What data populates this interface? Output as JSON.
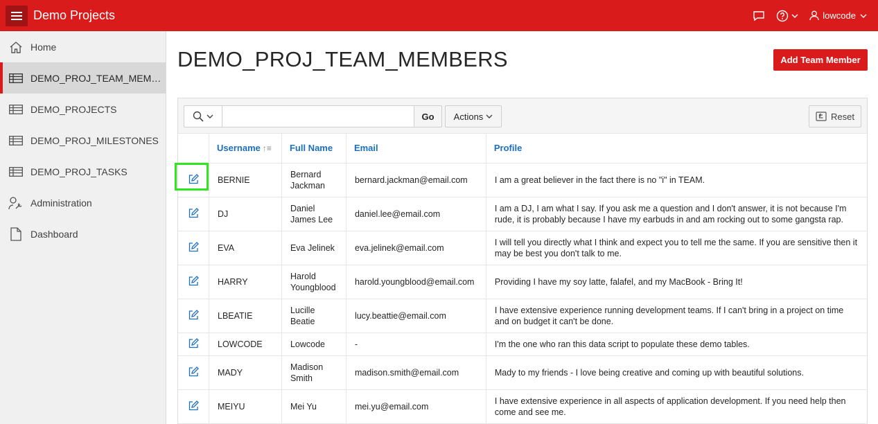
{
  "app": {
    "title": "Demo Projects"
  },
  "topbar": {
    "user_name": "lowcode"
  },
  "sidebar": {
    "items": [
      {
        "label": "Home",
        "icon": "home-icon"
      },
      {
        "label": "DEMO_PROJ_TEAM_MEMBERS",
        "icon": "table-icon",
        "active": true
      },
      {
        "label": "DEMO_PROJECTS",
        "icon": "table-icon"
      },
      {
        "label": "DEMO_PROJ_MILESTONES",
        "icon": "table-icon"
      },
      {
        "label": "DEMO_PROJ_TASKS",
        "icon": "table-icon"
      },
      {
        "label": "Administration",
        "icon": "wrench-user-icon"
      },
      {
        "label": "Dashboard",
        "icon": "document-icon"
      }
    ]
  },
  "page": {
    "title": "DEMO_PROJ_TEAM_MEMBERS",
    "add_button_label": "Add Team Member"
  },
  "report": {
    "search": {
      "value": "",
      "placeholder": ""
    },
    "go_label": "Go",
    "actions_label": "Actions",
    "reset_label": "Reset",
    "columns": [
      "Username",
      "Full Name",
      "Email",
      "Profile"
    ],
    "sorted_column": "Username",
    "rows": [
      {
        "username": "BERNIE",
        "full_name": "Bernard Jackman",
        "email": "bernard.jackman@email.com",
        "profile": "I am a great believer in the fact there is no \"i\" in TEAM."
      },
      {
        "username": "DJ",
        "full_name": "Daniel James Lee",
        "email": "daniel.lee@email.com",
        "profile": "I am a DJ, I am what I say. If you ask me a question and I don't answer, it is not because I'm rude, it is probably because I have my earbuds in and am rocking out to some gangsta rap."
      },
      {
        "username": "EVA",
        "full_name": "Eva Jelinek",
        "email": "eva.jelinek@email.com",
        "profile": "I will tell you directly what I think and expect you to tell me the same. If you are sensitive then it may be best you don't talk to me."
      },
      {
        "username": "HARRY",
        "full_name": "Harold Youngblood",
        "email": "harold.youngblood@email.com",
        "profile": "Providing I have my soy latte, falafel, and my MacBook - Bring It!"
      },
      {
        "username": "LBEATIE",
        "full_name": "Lucille Beatie",
        "email": "lucy.beattie@email.com",
        "profile": "I have extensive experience running development teams. If I can't bring in a project on time and on budget it can't be done."
      },
      {
        "username": "LOWCODE",
        "full_name": "Lowcode",
        "email": "-",
        "profile": "I'm the one who ran this data script to populate these demo tables."
      },
      {
        "username": "MADY",
        "full_name": "Madison Smith",
        "email": "madison.smith@email.com",
        "profile": "Mady to my friends - I love being creative and coming up with beautiful solutions."
      },
      {
        "username": "MEIYU",
        "full_name": "Mei Yu",
        "email": "mei.yu@email.com",
        "profile": "I have extensive experience in all aspects of application development. If you need help then come and see me."
      }
    ]
  },
  "colors": {
    "brand": "#da1b1b",
    "link": "#1a6fc0",
    "highlight": "#2ee81d"
  }
}
